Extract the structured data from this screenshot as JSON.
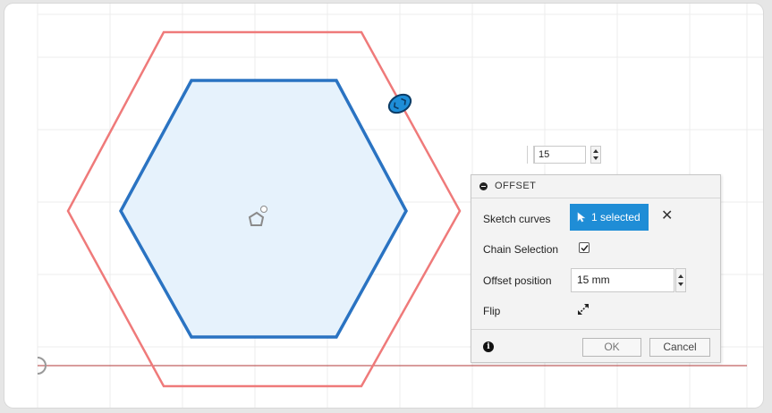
{
  "value_input": {
    "value": "15"
  },
  "offset_panel": {
    "title": "OFFSET",
    "rows": {
      "sketch_curves": {
        "label": "Sketch curves",
        "selection": "1 selected"
      },
      "chain_selection": {
        "label": "Chain Selection",
        "checked": true
      },
      "offset_position": {
        "label": "Offset position",
        "value": "15 mm"
      },
      "flip": {
        "label": "Flip"
      }
    },
    "buttons": {
      "ok": "OK",
      "cancel": "Cancel"
    }
  },
  "colors": {
    "inner_profile": "#2a73c2",
    "inner_fill": "#e6f2fc",
    "offset_curve": "#ef7a7a",
    "selection_blue": "#1f8dd6",
    "grid": "#ececec",
    "axis": "#b33a3a"
  },
  "icons": [
    "collapse-icon",
    "cursor-icon",
    "close-icon",
    "checkbox-check-icon",
    "flip-icon",
    "info-icon",
    "handle-icon",
    "center-point-icon"
  ]
}
